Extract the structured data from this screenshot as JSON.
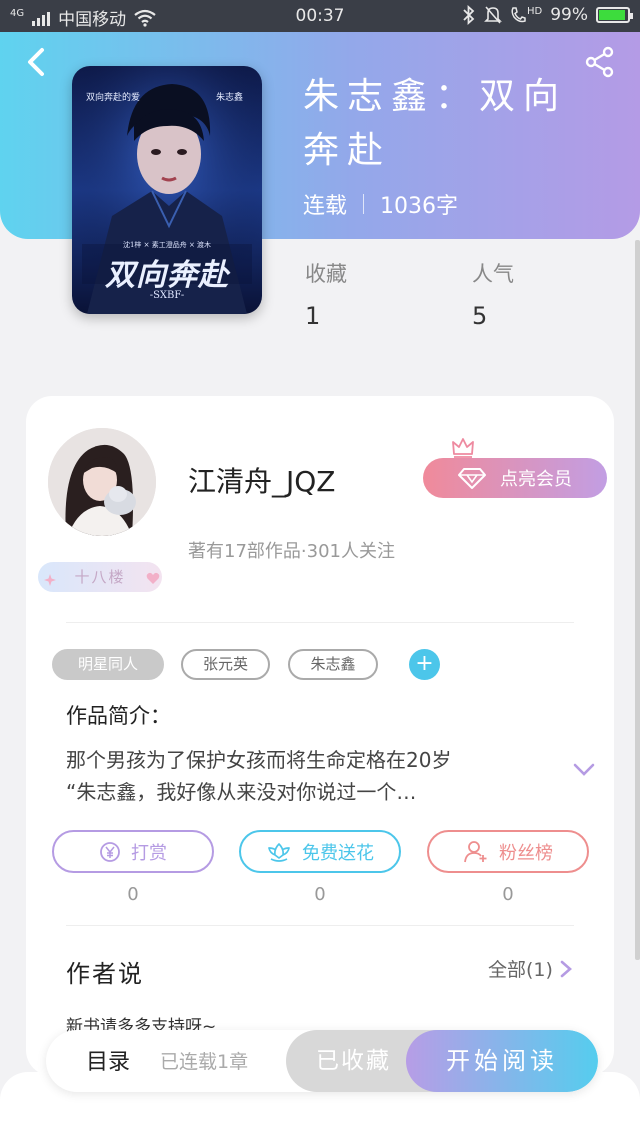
{
  "status_bar": {
    "carrier": "中国移动",
    "network": "4G",
    "time": "00:37",
    "hd": "HD",
    "battery_text": "99%",
    "battery_level": 0.99,
    "battery_color": "#3ddc3d"
  },
  "book": {
    "title": "朱志鑫：双向奔赴",
    "status": "连载",
    "word_count": "1036字",
    "cover": {
      "top_left_text": "双向奔赴的爱",
      "top_right_text": "朱志鑫",
      "credits_text": "沈1梓 × 素工澄品舟 × 渡木",
      "big_title": "双向奔赴",
      "subtitle": "-SXBF-"
    },
    "stats": [
      {
        "label": "收藏",
        "value": "1"
      },
      {
        "label": "人气",
        "value": "5"
      }
    ]
  },
  "author": {
    "name": "江清舟_JQZ",
    "info": "著有17部作品·301人关注",
    "level_badge": "十八楼",
    "vip_button": "点亮会员"
  },
  "tags": [
    {
      "label": "明星同人",
      "style": "filled"
    },
    {
      "label": "张元英",
      "style": "outline"
    },
    {
      "label": "朱志鑫",
      "style": "outline"
    }
  ],
  "intro": {
    "title": "作品简介：",
    "line1": "那个男孩为了保护女孩而将生命定格在20岁",
    "line2": "“朱志鑫，我好像从来没对你说过一个…"
  },
  "actions": [
    {
      "label": "打赏",
      "count": "0",
      "color": "#b59be3",
      "icon": "yen-coin-icon"
    },
    {
      "label": "免费送花",
      "count": "0",
      "color": "#4cc6ea",
      "icon": "flower-icon"
    },
    {
      "label": "粉丝榜",
      "count": "0",
      "color": "#ee8e8e",
      "icon": "fan-user-icon"
    }
  ],
  "author_says": {
    "title": "作者说",
    "all_link": "全部(1)",
    "note": "新书请多多支持呀~"
  },
  "bottom": {
    "toc": "目录",
    "toc_sub": "已连载1章",
    "fav": "已收藏",
    "read": "开始阅读"
  },
  "colors": {
    "gradient_start": "#5fd3ef",
    "gradient_end": "#b49be6",
    "accent_blue": "#4cc6ea",
    "accent_purple": "#b59be3"
  }
}
